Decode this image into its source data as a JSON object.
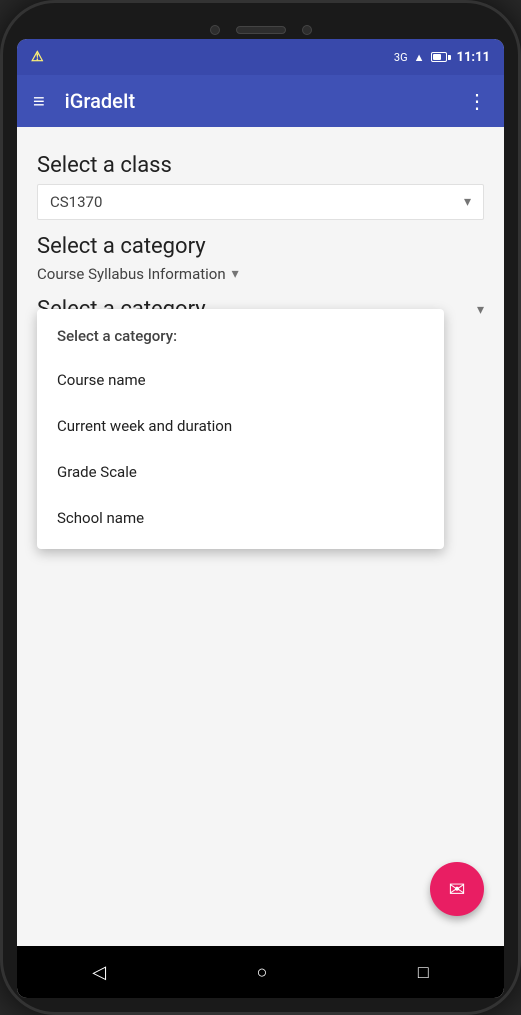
{
  "status": {
    "time": "11:11",
    "signal": "3G",
    "warning": "⚠"
  },
  "appBar": {
    "title": "iGradeIt",
    "menuIcon": "≡",
    "moreIcon": "⋮"
  },
  "content": {
    "selectClass": {
      "label": "Select a class",
      "value": "CS1370",
      "arrow": "▾"
    },
    "selectCategory1": {
      "label": "Select a category",
      "value": "Course Syllabus Information",
      "arrow": "▾"
    },
    "selectCategory2": {
      "label": "Select a category",
      "arrow": "▾"
    },
    "dropdown": {
      "header": "Select a category:",
      "items": [
        "Course name",
        "Current week and duration",
        "Grade Scale",
        "School name"
      ]
    }
  },
  "fab": {
    "icon": "✉",
    "label": "email"
  },
  "bottomNav": {
    "back": "◁",
    "home": "○",
    "recent": "□"
  }
}
